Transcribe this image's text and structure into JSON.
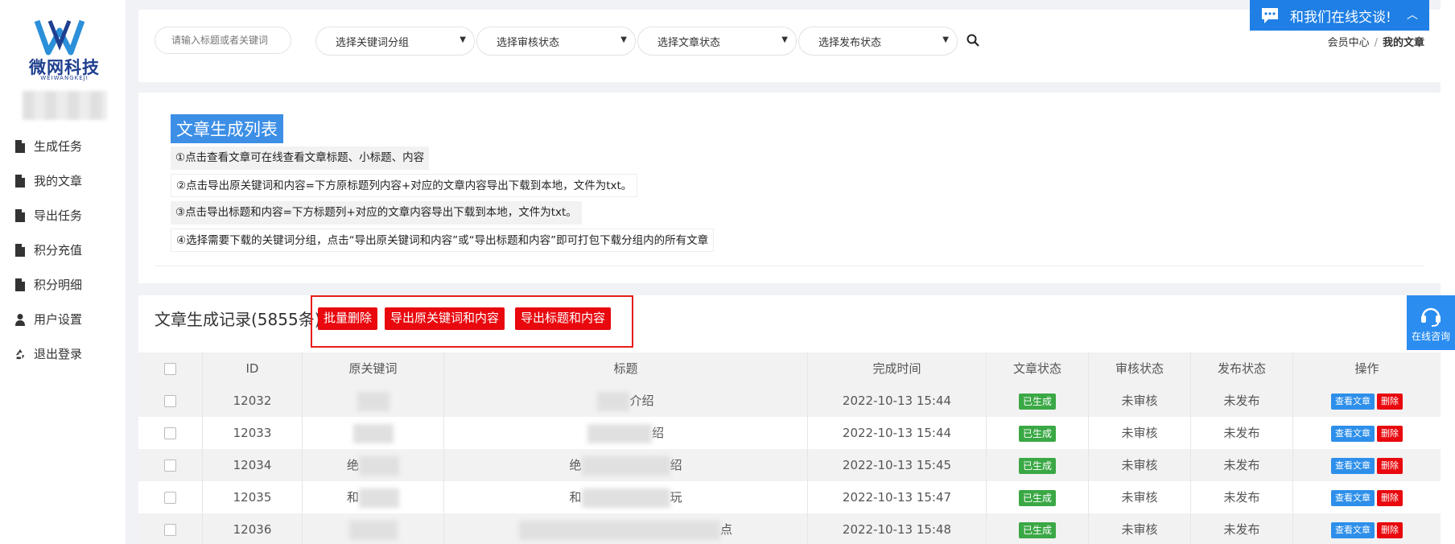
{
  "logo": {
    "text": "微网科技",
    "sub": "WEIWANGKEJI"
  },
  "sidebar": {
    "items": [
      {
        "label": "生成任务",
        "icon": "file-icon"
      },
      {
        "label": "我的文章",
        "icon": "file-icon"
      },
      {
        "label": "导出任务",
        "icon": "file-icon"
      },
      {
        "label": "积分充值",
        "icon": "file-icon"
      },
      {
        "label": "积分明细",
        "icon": "file-icon"
      },
      {
        "label": "用户设置",
        "icon": "user-icon"
      },
      {
        "label": "退出登录",
        "icon": "recycle-icon"
      }
    ]
  },
  "filters": {
    "search_placeholder": "请输入标题或者关键词",
    "keyword_group": "选择关键词分组",
    "review_status": "选择审核状态",
    "article_status": "选择文章状态",
    "publish_status": "选择发布状态"
  },
  "breadcrumb": {
    "home": "会员中心",
    "sep": "/",
    "current": "我的文章"
  },
  "info": {
    "title": "文章生成列表",
    "tips": [
      "①点击查看文章可在线查看文章标题、小标题、内容",
      "②点击导出原关键词和内容=下方原标题列内容+对应的文章内容导出下载到本地，文件为txt。",
      "③点击导出标题和内容=下方标题列+对应的文章内容导出下载到本地，文件为txt。",
      "④选择需要下载的关键词分组，点击“导出原关键词和内容”或“导出标题和内容”即可打包下载分组内的所有文章"
    ]
  },
  "records": {
    "title": "文章生成记录(5855条)",
    "btn_batch_delete": "批量删除",
    "btn_export_keyword": "导出原关键词和内容",
    "btn_export_title": "导出标题和内容",
    "columns": [
      "",
      "ID",
      "原关键词",
      "标题",
      "完成时间",
      "文章状态",
      "审核状态",
      "发布状态",
      "操作"
    ],
    "rows": [
      {
        "id": "12032",
        "keyword": "",
        "title": "介绍",
        "time": "2022-10-13 15:44",
        "status": "已生成",
        "review": "未审核",
        "publish": "未发布"
      },
      {
        "id": "12033",
        "keyword": "",
        "title": "绍",
        "time": "2022-10-13 15:44",
        "status": "已生成",
        "review": "未审核",
        "publish": "未发布"
      },
      {
        "id": "12034",
        "keyword": "绝",
        "title": "绝",
        "title_end": "绍",
        "time": "2022-10-13 15:45",
        "status": "已生成",
        "review": "未审核",
        "publish": "未发布"
      },
      {
        "id": "12035",
        "keyword": "和",
        "title": "和",
        "title_end": "玩",
        "time": "2022-10-13 15:47",
        "status": "已生成",
        "review": "未审核",
        "publish": "未发布"
      },
      {
        "id": "12036",
        "keyword": "",
        "title": "",
        "title_end": "点",
        "time": "2022-10-13 15:48",
        "status": "已生成",
        "review": "未审核",
        "publish": "未发布"
      }
    ],
    "action_view": "查看文章",
    "action_delete": "删除"
  },
  "chat": {
    "label": "和我们在线交谈!",
    "consult": "在线咨询"
  },
  "colors": {
    "brand": "#1f3f8f",
    "accent": "#1f7fe5",
    "danger": "#e8080e",
    "success": "#3aa845"
  }
}
